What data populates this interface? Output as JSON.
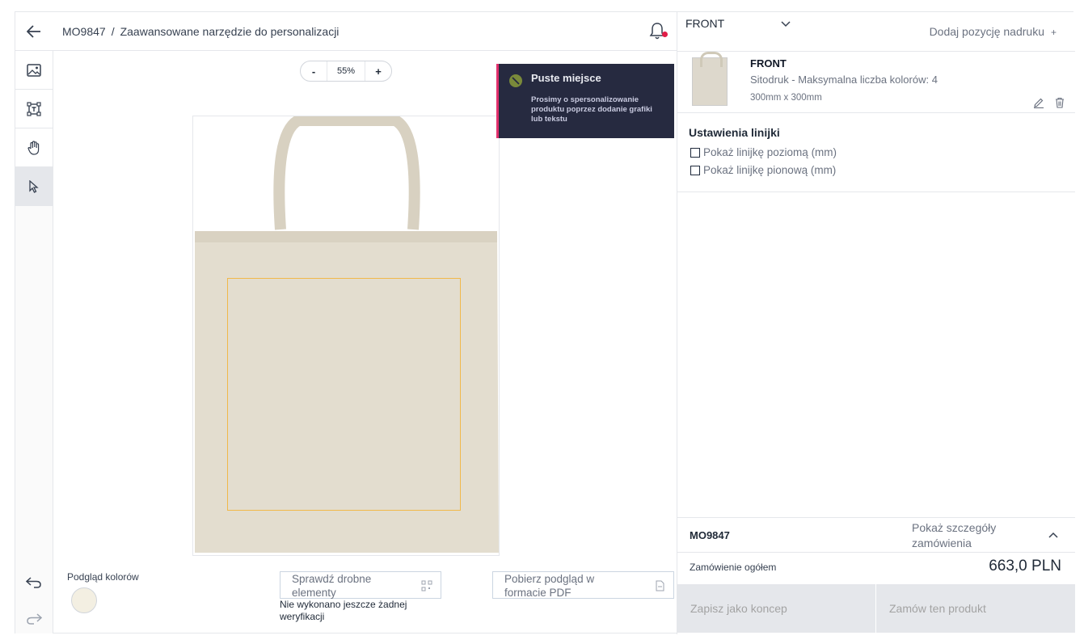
{
  "header": {
    "breadcrumb_code": "MO9847",
    "breadcrumb_sep": "/",
    "breadcrumb_title": "Zaawansowane narzędzie do personalizacji"
  },
  "toolbar": {
    "tools": [
      "image-icon",
      "text-frame-icon",
      "hand-icon",
      "pointer-icon"
    ],
    "undo_icon": "undo-icon",
    "redo_icon": "redo-icon"
  },
  "zoom": {
    "minus": "-",
    "value": "55%",
    "plus": "+"
  },
  "toast": {
    "title": "Puste miejsce",
    "message": "Prosimy o spersonalizowanie produktu poprzez dodanie grafiki lub tekstu"
  },
  "canvas": {
    "color_preview_label": "Podgląd kolorów",
    "check_button": "Sprawdź drobne elementy",
    "pdf_button": "Pobierz podgląd w formacie PDF",
    "verify_note": "Nie wykonano jeszcze żadnej weryfikacji",
    "bag_color": "#e3ddcf",
    "print_area_color": "#f1b84a"
  },
  "right_panel": {
    "side_select": "FRONT",
    "add_position": "Dodaj pozycję nadruku",
    "add_position_plus": "+",
    "position": {
      "title": "FRONT",
      "method": "Sitodruk - Maksymalna liczba kolorów: 4",
      "size": "300mm x 300mm"
    },
    "ruler_title": "Ustawienia linijki",
    "ruler_horizontal": "Pokaż linijkę poziomą (mm)",
    "ruler_vertical": "Pokaż linijkę pionową (mm)",
    "order_code": "MO9847",
    "order_details": "Pokaż szczegóły zamówienia",
    "order_total_label": "Zamówienie ogółem",
    "order_total": "663,0 PLN",
    "save_concept": "Zapisz jako koncep",
    "order_product": "Zamów ten produkt"
  }
}
